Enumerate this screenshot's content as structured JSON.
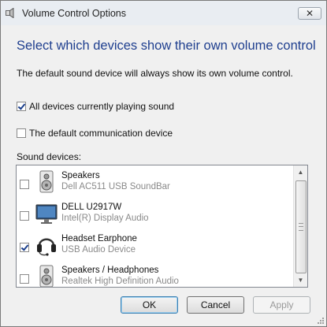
{
  "window": {
    "title": "Volume Control Options",
    "close_glyph": "✕"
  },
  "heading": "Select which devices show their own volume control",
  "description": "The default sound device will always show its own volume control.",
  "options": [
    {
      "label": "All devices currently playing sound",
      "checked": true
    },
    {
      "label": "The default communication device",
      "checked": false
    }
  ],
  "sound_devices_label": "Sound devices:",
  "devices": [
    {
      "name": "Speakers",
      "subtitle": "Dell AC511 USB SoundBar",
      "icon": "speaker-icon",
      "checked": false
    },
    {
      "name": "DELL U2917W",
      "subtitle": "Intel(R) Display Audio",
      "icon": "monitor-icon",
      "checked": false
    },
    {
      "name": "Headset Earphone",
      "subtitle": "USB Audio Device",
      "icon": "headset-icon",
      "checked": true
    },
    {
      "name": "Speakers / Headphones",
      "subtitle": "Realtek High Definition Audio",
      "icon": "speaker-icon",
      "checked": false
    }
  ],
  "buttons": {
    "ok": "OK",
    "cancel": "Cancel",
    "apply": "Apply"
  }
}
